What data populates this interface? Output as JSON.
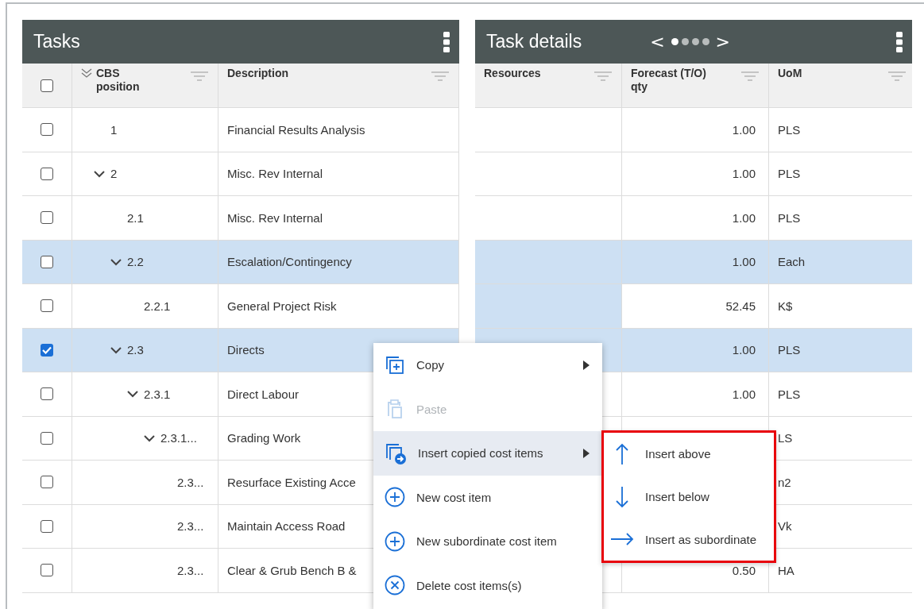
{
  "tasks": {
    "title": "Tasks",
    "select_all_checked": false,
    "columns": [
      {
        "label": "CBS\nposition"
      },
      {
        "label": "Description"
      }
    ],
    "rows": [
      {
        "cbs": "1",
        "description": "Financial Results Analysis",
        "checked": false,
        "selected": false,
        "expanded": false
      },
      {
        "cbs": "2",
        "description": "Misc. Rev Internal",
        "checked": false,
        "selected": false,
        "expanded": true,
        "children": [
          {
            "cbs": "2.1",
            "description": "Misc. Rev Internal",
            "checked": false,
            "selected": false,
            "expanded": false
          },
          {
            "cbs": "2.2",
            "description": "Escalation/Contingency",
            "checked": false,
            "selected": true,
            "expanded": true,
            "children": [
              {
                "cbs": "2.2.1",
                "description": "General Project Risk",
                "checked": false,
                "selected": false,
                "expanded": false
              }
            ]
          },
          {
            "cbs": "2.3",
            "description": "Directs",
            "checked": true,
            "selected": true,
            "expanded": true,
            "children": [
              {
                "cbs": "2.3.1",
                "description": "Direct Labour",
                "checked": false,
                "selected": false,
                "expanded": true,
                "children": [
                  {
                    "cbs": "2.3.1...",
                    "description": "Grading Work",
                    "checked": false,
                    "selected": false,
                    "expanded": true,
                    "children": [
                      {
                        "cbs": "2.3...",
                        "description": "Resurface Existing Acce",
                        "checked": false,
                        "selected": false,
                        "expanded": false
                      },
                      {
                        "cbs": "2.3...",
                        "description": "Maintain Access Road",
                        "checked": false,
                        "selected": false,
                        "expanded": false
                      },
                      {
                        "cbs": "2.3...",
                        "description": "Clear & Grub Bench B &",
                        "checked": false,
                        "selected": false,
                        "expanded": false
                      }
                    ]
                  }
                ]
              }
            ]
          }
        ]
      }
    ]
  },
  "task_details": {
    "title": "Task details",
    "pager": {
      "prev": "<",
      "next": ">",
      "dots": [
        {
          "selected": true
        },
        {
          "selected": false
        },
        {
          "selected": false
        },
        {
          "selected": false
        }
      ]
    },
    "columns": [
      {
        "label": "Resources"
      },
      {
        "label": "Forecast (T/O)\nqty"
      },
      {
        "label": "UoM"
      }
    ],
    "rows": [
      {
        "qty": "1.00",
        "uom": "PLS",
        "selected": false,
        "resources_selected": false
      },
      {
        "qty": "1.00",
        "uom": "PLS",
        "selected": false,
        "resources_selected": false
      },
      {
        "qty": "1.00",
        "uom": "PLS",
        "selected": false,
        "resources_selected": false
      },
      {
        "qty": "1.00",
        "uom": "Each",
        "selected": true,
        "resources_selected": true
      },
      {
        "qty": "52.45",
        "uom": "K$",
        "selected": false,
        "resources_selected": true
      },
      {
        "qty": "1.00",
        "uom": "PLS",
        "selected": true,
        "resources_selected": true
      },
      {
        "qty": "1.00",
        "uom": "PLS",
        "selected": false,
        "resources_selected": false
      },
      {
        "uom": "LS",
        "selected": false,
        "resources_selected": false
      },
      {
        "uom": "n2",
        "selected": false
      },
      {
        "uom": "Vk",
        "selected": false
      },
      {
        "qty": "0.50",
        "uom": "HA",
        "selected": false,
        "resources_selected": false
      }
    ]
  },
  "context_menu": {
    "items": [
      {
        "kind": "copy",
        "label": "Copy",
        "disabled": false,
        "selected": false,
        "submenu": true
      },
      {
        "kind": "paste",
        "label": "Paste",
        "disabled": true,
        "selected": false,
        "submenu": false
      },
      {
        "kind": "insert",
        "label": "Insert copied cost items",
        "disabled": false,
        "selected": true,
        "submenu": true
      },
      {
        "kind": "new",
        "label": "New cost item",
        "disabled": false,
        "selected": false,
        "submenu": false
      },
      {
        "kind": "new",
        "label": "New subordinate cost item",
        "disabled": false,
        "selected": false,
        "submenu": false
      },
      {
        "kind": "delete",
        "label": "Delete cost items(s)",
        "disabled": false,
        "selected": false,
        "submenu": false
      }
    ]
  },
  "submenu": {
    "items": [
      {
        "kind": "up",
        "label": "Insert above"
      },
      {
        "kind": "down",
        "label": "Insert below"
      },
      {
        "kind": "right",
        "label": "Insert as subordinate"
      }
    ]
  }
}
